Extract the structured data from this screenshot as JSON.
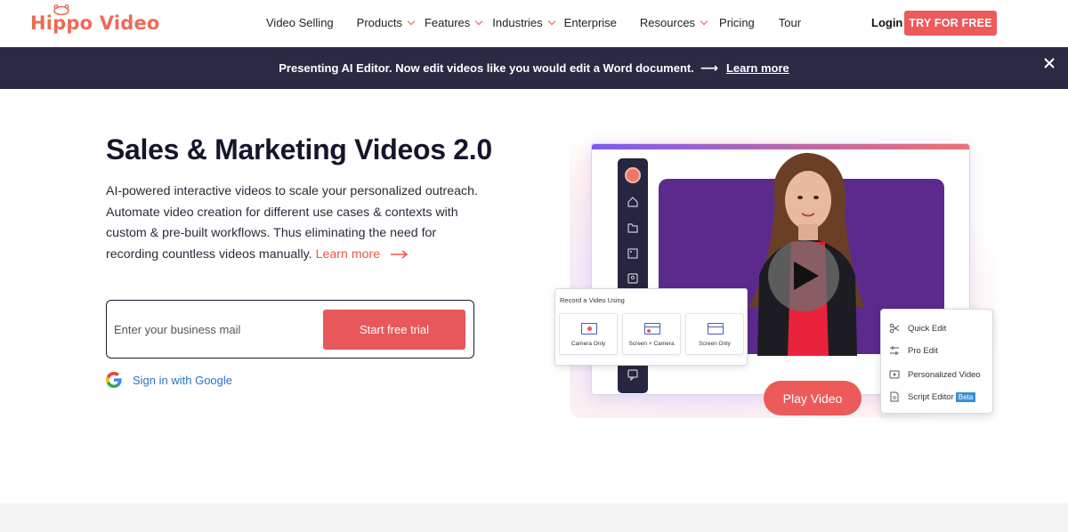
{
  "brand": {
    "name": "Hippo Video",
    "accent": "#ee6a55",
    "cta": "#ec5a5a",
    "banner_bg": "#2b2a45"
  },
  "nav": {
    "items": [
      {
        "label": "Video Selling",
        "dropdown": false
      },
      {
        "label": "Products",
        "dropdown": true
      },
      {
        "label": "Features",
        "dropdown": true
      },
      {
        "label": "Industries",
        "dropdown": true
      },
      {
        "label": "Enterprise",
        "dropdown": false
      },
      {
        "label": "Resources",
        "dropdown": true
      },
      {
        "label": "Pricing",
        "dropdown": false
      },
      {
        "label": "Tour",
        "dropdown": false
      }
    ],
    "login": "Login",
    "cta": "TRY FOR FREE"
  },
  "banner": {
    "text": "Presenting AI Editor. Now edit videos like you would edit a Word document.",
    "arrow": "⟶",
    "link": "Learn more"
  },
  "hero": {
    "title": "Sales & Marketing Videos 2.0",
    "description": "AI-powered interactive videos to scale your personalized outreach. Automate video creation for different use cases & contexts with custom & pre-built workflows. Thus eliminating the need for recording countless videos manually.",
    "learn_more": "Learn more",
    "email_placeholder": "Enter your business mail",
    "start_button": "Start free trial",
    "google_signin": "Sign in with Google"
  },
  "mockup": {
    "record_title": "Record a Video Using",
    "record_options": [
      "Camera Only",
      "Screen + Camera",
      "Screen Only"
    ],
    "edit_options": [
      "Quick Edit",
      "Pro Edit",
      "Personalized Video",
      "Script Editor"
    ],
    "beta_badge": "Beta",
    "play_button": "Play Video"
  }
}
